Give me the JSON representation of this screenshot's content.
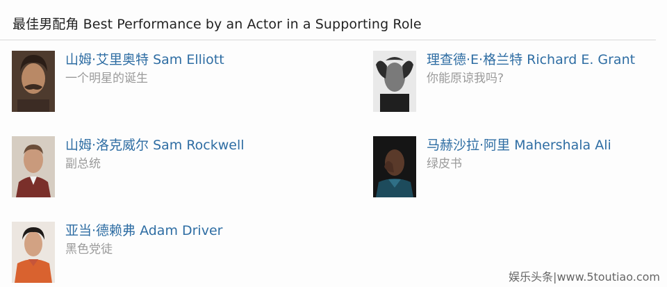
{
  "section": {
    "title": "最佳男配角 Best Performance by an Actor in a Supporting Role"
  },
  "nominees": [
    {
      "name": "山姆·艾里奥特 Sam Elliott",
      "film": "一个明星的诞生"
    },
    {
      "name": "理查德·E·格兰特 Richard E. Grant",
      "film": "你能原谅我吗?"
    },
    {
      "name": "山姆·洛克威尔 Sam Rockwell",
      "film": "副总统"
    },
    {
      "name": "马赫沙拉·阿里 Mahershala Ali",
      "film": "绿皮书"
    },
    {
      "name": "亚当·德赖弗 Adam Driver",
      "film": "黑色党徒"
    }
  ],
  "watermark": {
    "text": "娱乐头条|www.5toutiao.com"
  },
  "colors": {
    "link": "#2e6da3",
    "muted": "#9a9a9a",
    "title": "#222222",
    "rule": "#d8d8d8"
  }
}
